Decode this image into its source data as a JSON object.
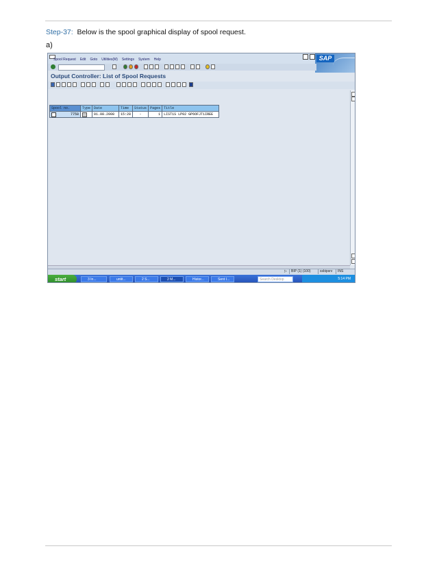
{
  "doc": {
    "step_label": "Step-37:",
    "step_text": "Below is the spool graphical display of spool request.",
    "sub_label": "a)"
  },
  "sap": {
    "menu": [
      "Spool Request",
      "Edit",
      "Goto",
      "Utilities(M)",
      "Settings",
      "System",
      "Help"
    ],
    "logo": "SAP",
    "screen_title": "Output Controller: List of Spool Requests",
    "table": {
      "headers": [
        "Spool no.",
        "Type",
        "Date",
        "Time",
        "Status",
        "Pages",
        "Title"
      ],
      "rows": [
        {
          "spool_no": "7758",
          "date": "01.08.2008",
          "time": "15:28",
          "status": "-",
          "pages": "1",
          "title": "LIST1S LP02 GP6OFJT1IREE"
        }
      ]
    },
    "status_bar": {
      "system": "BIP (1) (100)",
      "server": "ssbipsrv",
      "mode": "INS"
    }
  },
  "taskbar": {
    "start": "start",
    "items": [
      "3 In...",
      "untit...",
      "2 S...",
      "2 M...",
      "Histor...",
      "Sent I..."
    ],
    "search_placeholder": "Search Desktop",
    "clock": "5:14 PM"
  },
  "colors": {
    "accent": "#2f6ea5",
    "selection": "#8ec4ee",
    "taskbar": "#2450b5"
  }
}
